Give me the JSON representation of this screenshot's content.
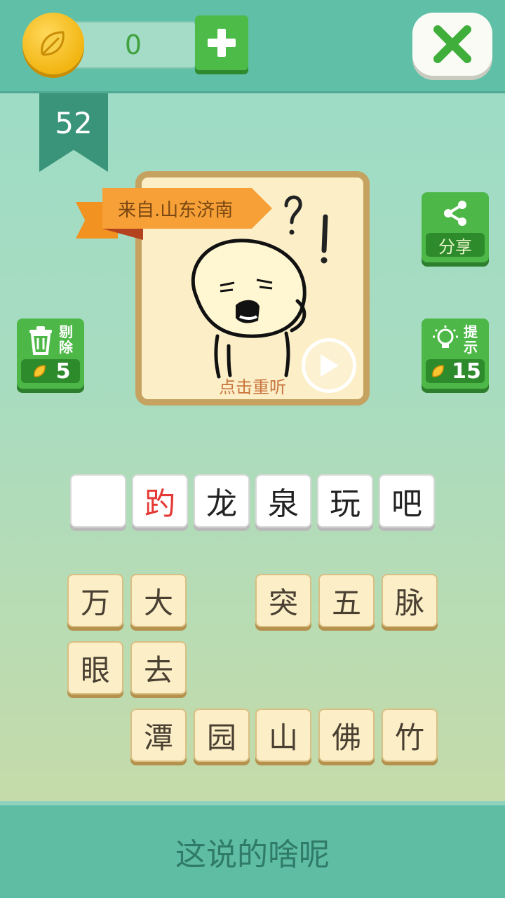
{
  "header": {
    "coin_count": "0",
    "level": "52"
  },
  "puzzle": {
    "origin_tag": "来自.山东济南",
    "replay_label": "点击重听"
  },
  "side_buttons": {
    "share_label": "分享",
    "remove_label_1": "剔",
    "remove_label_2": "除",
    "remove_cost": "5",
    "hint_label_1": "提",
    "hint_label_2": "示",
    "hint_cost": "15"
  },
  "answer_slots": [
    "",
    "趵",
    "龙",
    "泉",
    "玩",
    "吧"
  ],
  "choices_row1": [
    "万",
    "大",
    "",
    "突",
    "五",
    "脉"
  ],
  "choices_row2": [
    "眼",
    "去"
  ],
  "choices_row3": [
    "潭",
    "园",
    "山",
    "佛",
    "竹"
  ],
  "footer": {
    "question": "这说的啥呢"
  },
  "colors": {
    "accent_green": "#4db847",
    "highlight_red": "#e53935",
    "coin_gold": "#f2b613"
  },
  "icons": [
    "coin-leaf-icon",
    "plus-icon",
    "close-x-icon",
    "share-icon",
    "trash-icon",
    "lightbulb-icon",
    "play-icon"
  ]
}
